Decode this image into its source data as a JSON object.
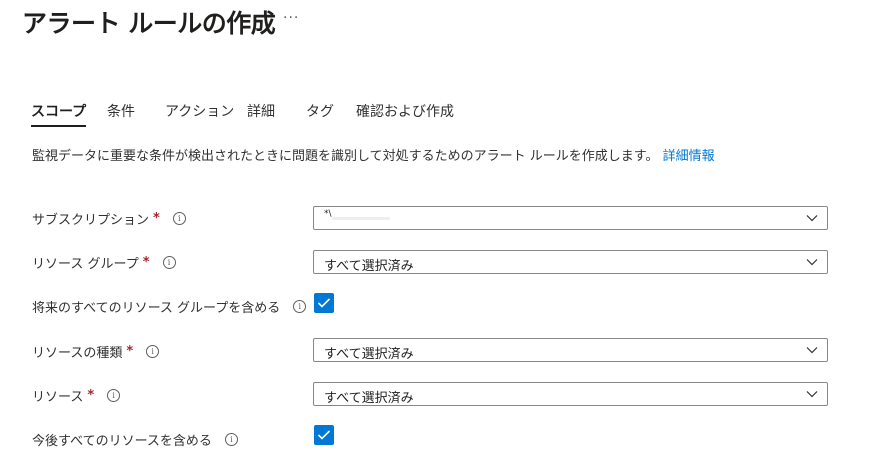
{
  "header": {
    "title": "アラート ルールの作成",
    "more_label": "···"
  },
  "tabs": [
    {
      "label": "スコープ"
    },
    {
      "label": "条件"
    },
    {
      "label": "アクション"
    },
    {
      "label": "詳細"
    },
    {
      "label": "タグ"
    },
    {
      "label": "確認および作成"
    }
  ],
  "description": {
    "text": "監視データに重要な条件が検出されたときに問題を識別して対処するためのアラート ルールを作成します。",
    "link": "詳細情報"
  },
  "form": {
    "subscription": {
      "label": "サブスクリプション",
      "required": "*",
      "value": "*\\"
    },
    "resource_group": {
      "label": "リソース グループ",
      "required": "*",
      "value": "すべて選択済み"
    },
    "include_future_groups": {
      "label": "将来のすべてのリソース グループを含める",
      "checked": true
    },
    "resource_type": {
      "label": "リソースの種類",
      "required": "*",
      "value": "すべて選択済み"
    },
    "resource": {
      "label": "リソース",
      "required": "*",
      "value": "すべて選択済み"
    },
    "include_future_resources": {
      "label": "今後すべてのリソースを含める",
      "checked": true
    }
  },
  "icons": {
    "info": "info-icon",
    "chevron": "chevron-down-icon",
    "check": "checkmark-icon"
  },
  "colors": {
    "accent": "#0078d4",
    "required": "#a4262c",
    "text": "#323130",
    "border": "#8a8886"
  }
}
